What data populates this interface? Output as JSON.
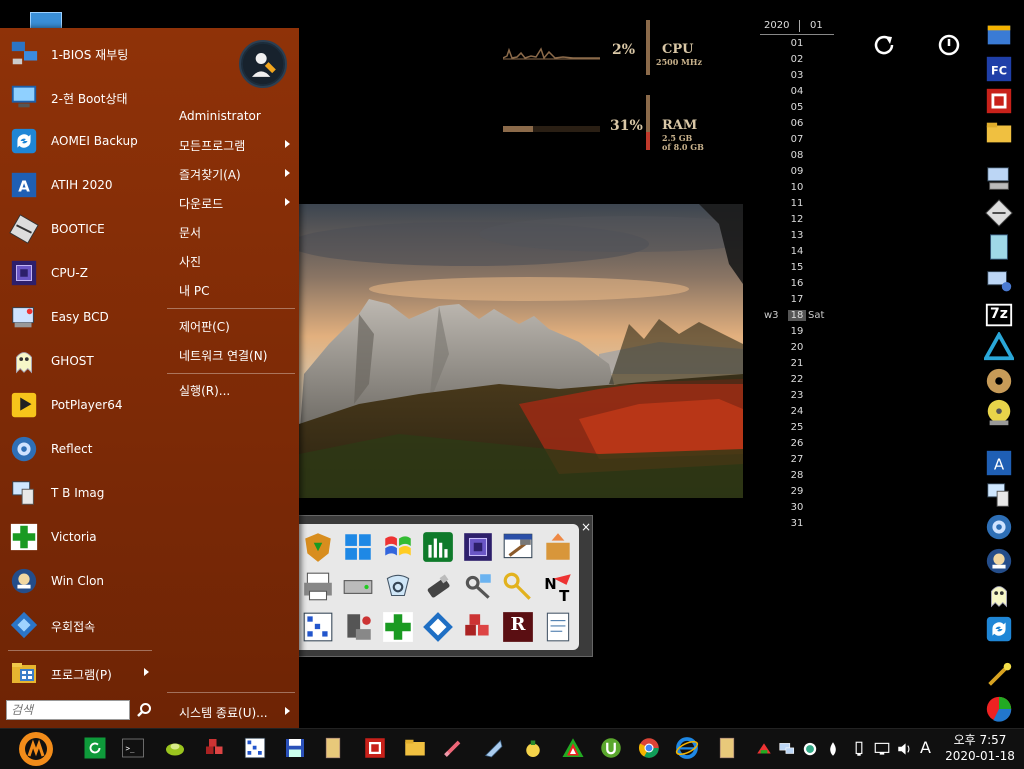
{
  "start_menu": {
    "programs": [
      {
        "label": "1-BIOS 재부팅",
        "icon": "network-computer-icon"
      },
      {
        "label": "2-현 Boot상태",
        "icon": "monitor-icon"
      },
      {
        "label": "AOMEI Backup",
        "icon": "backup-icon"
      },
      {
        "label": "ATIH 2020",
        "icon": "acronis-a-icon"
      },
      {
        "label": "BOOTICE",
        "icon": "bootice-icon"
      },
      {
        "label": "CPU-Z",
        "icon": "cpu-chip-icon"
      },
      {
        "label": "Easy BCD",
        "icon": "easybcd-icon"
      },
      {
        "label": "GHOST",
        "icon": "ghost-icon"
      },
      {
        "label": "PotPlayer64",
        "icon": "potplayer-icon"
      },
      {
        "label": "Reflect",
        "icon": "reflect-icon"
      },
      {
        "label": "T B Imag",
        "icon": "tbimage-icon"
      },
      {
        "label": "Victoria",
        "icon": "green-cross-icon"
      },
      {
        "label": "Win Clon",
        "icon": "winclon-icon"
      },
      {
        "label": "우회접속",
        "icon": "remote-icon"
      }
    ],
    "programs_label": "프로그램(P)",
    "search_placeholder": "검색",
    "user_name": "Administrator",
    "right_items": [
      {
        "label": "모든프로그램",
        "submenu": true
      },
      {
        "label": "즐겨찾기(A)",
        "submenu": true
      },
      {
        "label": "다운로드",
        "submenu": true
      },
      {
        "label": "문서",
        "submenu": false
      },
      {
        "label": "사진",
        "submenu": false
      },
      {
        "label": "내 PC",
        "submenu": false
      },
      {
        "label": "제어판(C)",
        "submenu": false
      },
      {
        "label": "네트워크 연결(N)",
        "submenu": false
      },
      {
        "label": "실행(R)...",
        "submenu": false
      }
    ],
    "shutdown_label": "시스템 종료(U)..."
  },
  "cpu_meter": {
    "percent": "2%",
    "label": "CPU",
    "sub": "2500 MHz"
  },
  "ram_meter": {
    "percent": "31%",
    "label": "RAM",
    "sub1": "2.5 GB",
    "sub2": "of 8.0 GB",
    "fill_fraction": 0.31
  },
  "calendar": {
    "year": "2020",
    "month": "01",
    "week_label": "w3",
    "weekday_label": "Sat",
    "today": "18",
    "days": [
      "01",
      "02",
      "03",
      "04",
      "05",
      "06",
      "07",
      "08",
      "09",
      "10",
      "11",
      "12",
      "13",
      "14",
      "15",
      "16",
      "17",
      "18",
      "19",
      "20",
      "21",
      "22",
      "23",
      "24",
      "25",
      "26",
      "27",
      "28",
      "29",
      "30",
      "31"
    ]
  },
  "top_icons": {
    "restart": "restart-icon",
    "power": "power-icon"
  },
  "launcher": {
    "close_glyph": "×",
    "rows": [
      [
        "shield-download-icon",
        "windows-logo-icon",
        "windows-flag-icon",
        "bar-chart-icon",
        "cpu-chip-icon",
        "hammer-window-icon",
        "package-icon"
      ],
      [
        "printer-icon",
        "drive-icon",
        "magnifier-icon",
        "usb-drive-icon",
        "key-network-icon",
        "keys-icon",
        "ntpwedit-icon"
      ],
      [
        "pixel-grid-icon",
        "disk-stack-icon",
        "green-cross-icon",
        "network-icon",
        "cubes-icon",
        "r-icon",
        "notepad-icon"
      ]
    ],
    "r_letter": "R"
  },
  "dock": [
    "setup-icon",
    "fc-icon",
    "grid-icon",
    "folder-icon",
    "computer-icon",
    "disk-icon",
    "notebook-icon",
    "settings-pc-icon",
    "7z-icon",
    "triangle-icon",
    "dvd-icon",
    "cd-icon",
    "acronis-a-icon",
    "tbimage-icon",
    "reflect-icon",
    "winclon-icon",
    "ghost-icon",
    "backup-icon",
    "wand-icon",
    "partition-icon"
  ],
  "dock_7z_text": "7z",
  "taskbar": {
    "time": "오후 7:57",
    "date": "2020-01-18",
    "ime_letter": "A",
    "icons": [
      "refresh-icon",
      "terminal-icon",
      "seed-icon",
      "cubes-icon",
      "pixel-grid-icon",
      "save-icon",
      "document-icon",
      "grid-icon",
      "folder-icon",
      "pen-icon",
      "ruler-icon",
      "bomb-icon",
      "triangle-color-icon",
      "utorrent-icon",
      "chrome-icon",
      "ie-icon",
      "document-icon"
    ],
    "tray": [
      "network-tray-icon",
      "display-tray-icon",
      "globe-tray-icon",
      "drop-tray-icon",
      "usb-tray-icon",
      "monitor-tray-icon",
      "volume-icon"
    ]
  }
}
